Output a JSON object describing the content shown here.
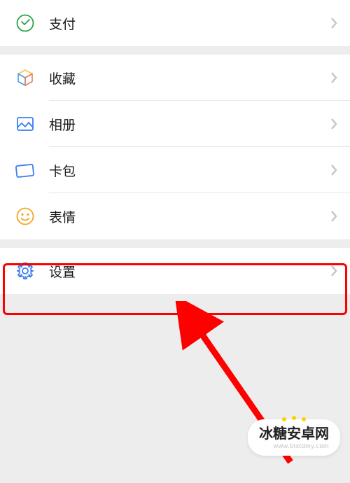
{
  "group1": {
    "items": [
      {
        "label": "支付",
        "icon": "pay-icon"
      }
    ]
  },
  "group2": {
    "items": [
      {
        "label": "收藏",
        "icon": "favorites-icon"
      },
      {
        "label": "相册",
        "icon": "album-icon"
      },
      {
        "label": "卡包",
        "icon": "cards-icon"
      },
      {
        "label": "表情",
        "icon": "emoticon-icon"
      }
    ]
  },
  "group3": {
    "items": [
      {
        "label": "设置",
        "icon": "settings-icon"
      }
    ]
  },
  "colors": {
    "pay": "#2ba245",
    "favorites_top": "#f9c349",
    "favorites_left": "#4a9de8",
    "favorites_right": "#e87c66",
    "album": "#3d7ef0",
    "cards": "#3d7ef0",
    "emoticon": "#f5a623",
    "settings": "#3d7ef0",
    "highlight": "#ff0000"
  },
  "watermark": {
    "text": "冰糖安卓网",
    "url": "www.btxtdmy.com"
  }
}
